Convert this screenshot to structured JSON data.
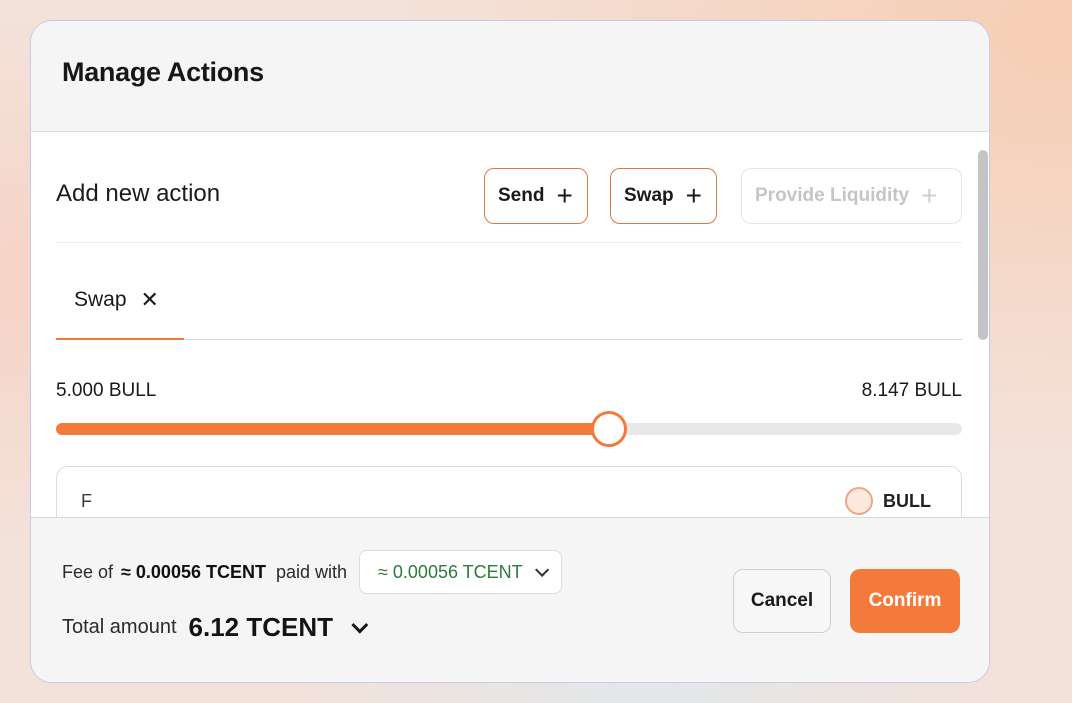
{
  "modal": {
    "title": "Manage Actions"
  },
  "add_action": {
    "title": "Add new action",
    "buttons": [
      {
        "label": "Send",
        "icon": "plus-icon",
        "enabled": true
      },
      {
        "label": "Swap",
        "icon": "plus-icon",
        "enabled": true
      },
      {
        "label": "Provide Liquidity",
        "icon": "plus-icon",
        "enabled": false
      }
    ]
  },
  "tabs": [
    {
      "label": "Swap",
      "active": true,
      "close_icon": "close-icon"
    }
  ],
  "range": {
    "min_label": "5.000 BULL",
    "max_label": "8.147 BULL",
    "position_fraction": 0.61
  },
  "swap_card": {
    "from_label": "F",
    "token": "BULL"
  },
  "footer": {
    "fee_prefix": "Fee of",
    "fee_amount": "≈ 0.00056 TCENT",
    "fee_paid_with": "paid with",
    "fee_token_select": "≈ 0.00056 TCENT",
    "total_label": "Total amount",
    "total_value": "6.12 TCENT",
    "cancel_label": "Cancel",
    "confirm_label": "Confirm"
  },
  "colors": {
    "accent": "#f47a3b",
    "fee_green": "#2d7b3a"
  }
}
